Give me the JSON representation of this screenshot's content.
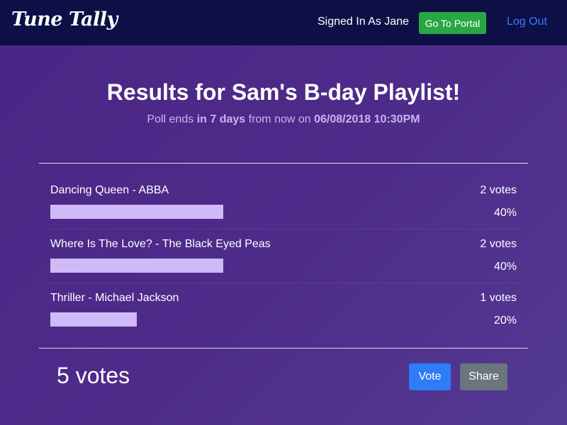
{
  "header": {
    "brand": "Tune Tally",
    "signed_in": "Signed In As Jane",
    "portal_label": "Go To Portal",
    "logout_label": "Log Out"
  },
  "poll": {
    "title": "Results for Sam's B-day Playlist!",
    "ends_prefix": "Poll ends",
    "ends_in": "in 7 days",
    "ends_mid": "from now on",
    "ends_at": "06/08/2018 10:30PM"
  },
  "results": [
    {
      "song": "Dancing Queen - ABBA",
      "votes": "2 votes",
      "percent": "40%",
      "fraction": 0.4
    },
    {
      "song": "Where Is The Love? - The Black Eyed Peas",
      "votes": "2 votes",
      "percent": "40%",
      "fraction": 0.4
    },
    {
      "song": "Thriller - Michael Jackson",
      "votes": "1 votes",
      "percent": "20%",
      "fraction": 0.2
    }
  ],
  "footer": {
    "total": "5 votes",
    "vote_label": "Vote",
    "share_label": "Share"
  },
  "colors": {
    "header_bg": "#0c1045",
    "page_bg": "#4e2c8a",
    "bar": "#cfbaf8",
    "portal_button": "#28a745",
    "vote_button": "#2e7cf6",
    "share_button": "#6c757d",
    "link": "#3b7bff"
  }
}
